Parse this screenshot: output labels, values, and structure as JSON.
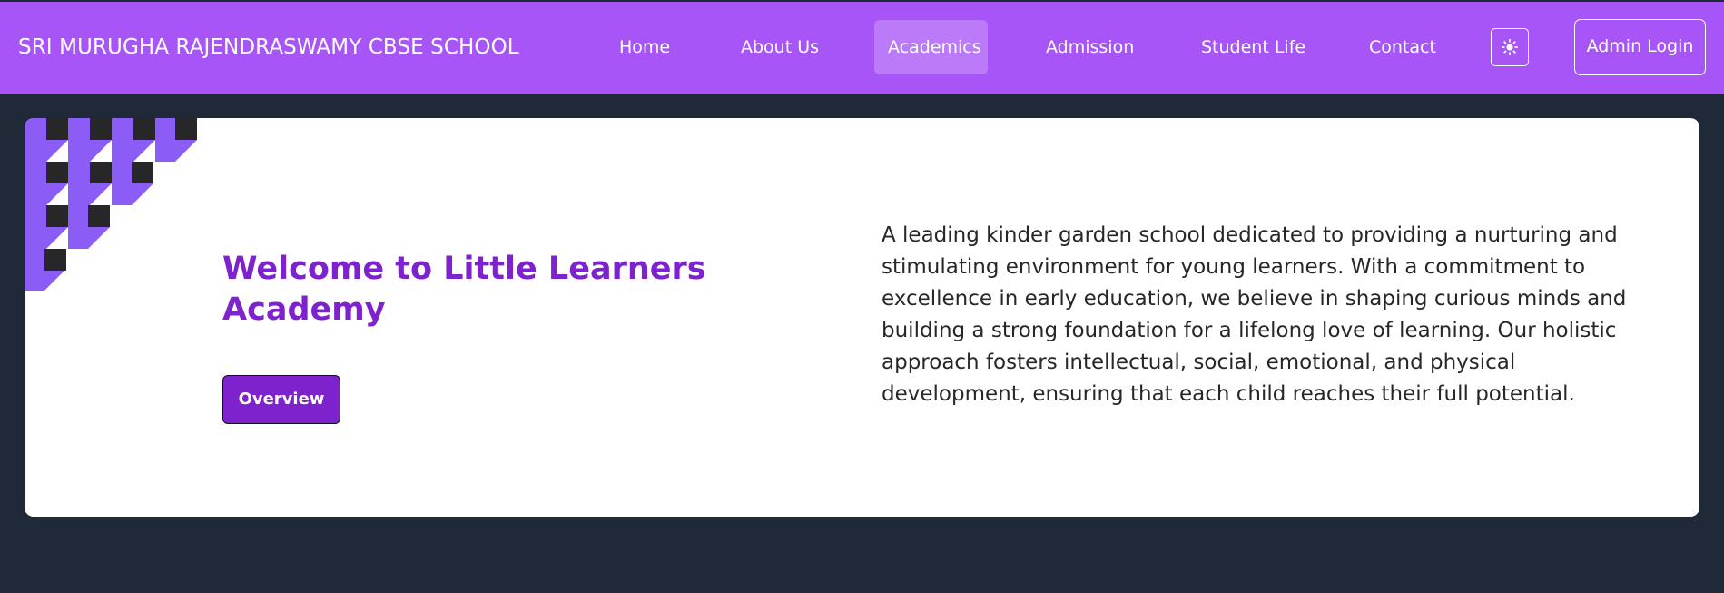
{
  "navbar": {
    "brand": "SRI MURUGHA RAJENDRASWAMY CBSE SCHOOL",
    "links": [
      {
        "label": "Home"
      },
      {
        "label": "About Us"
      },
      {
        "label": "Academics",
        "active": true
      },
      {
        "label": "Admission"
      },
      {
        "label": "Student Life"
      },
      {
        "label": "Contact"
      }
    ],
    "theme_toggle_icon": "sun-icon",
    "admin_login_label": "Admin Login"
  },
  "hero": {
    "headline": "Welcome to Little Learners Academy",
    "button_label": "Overview",
    "description": "A leading kinder garden school dedicated to providing a nurturing and stimulating environment for young learners. With a commitment to excellence in early education, we believe in shaping curious minds and building a strong foundation for a lifelong love of learning. Our holistic approach fosters intellectual, social, emotional, and physical development, ensuring that each child reaches their full potential."
  },
  "colors": {
    "navbar_bg": "#a855f7",
    "page_bg": "#1f2937",
    "accent": "#7e22ce",
    "pattern_purple": "#8b5cf6",
    "pattern_dark": "#27272a"
  }
}
